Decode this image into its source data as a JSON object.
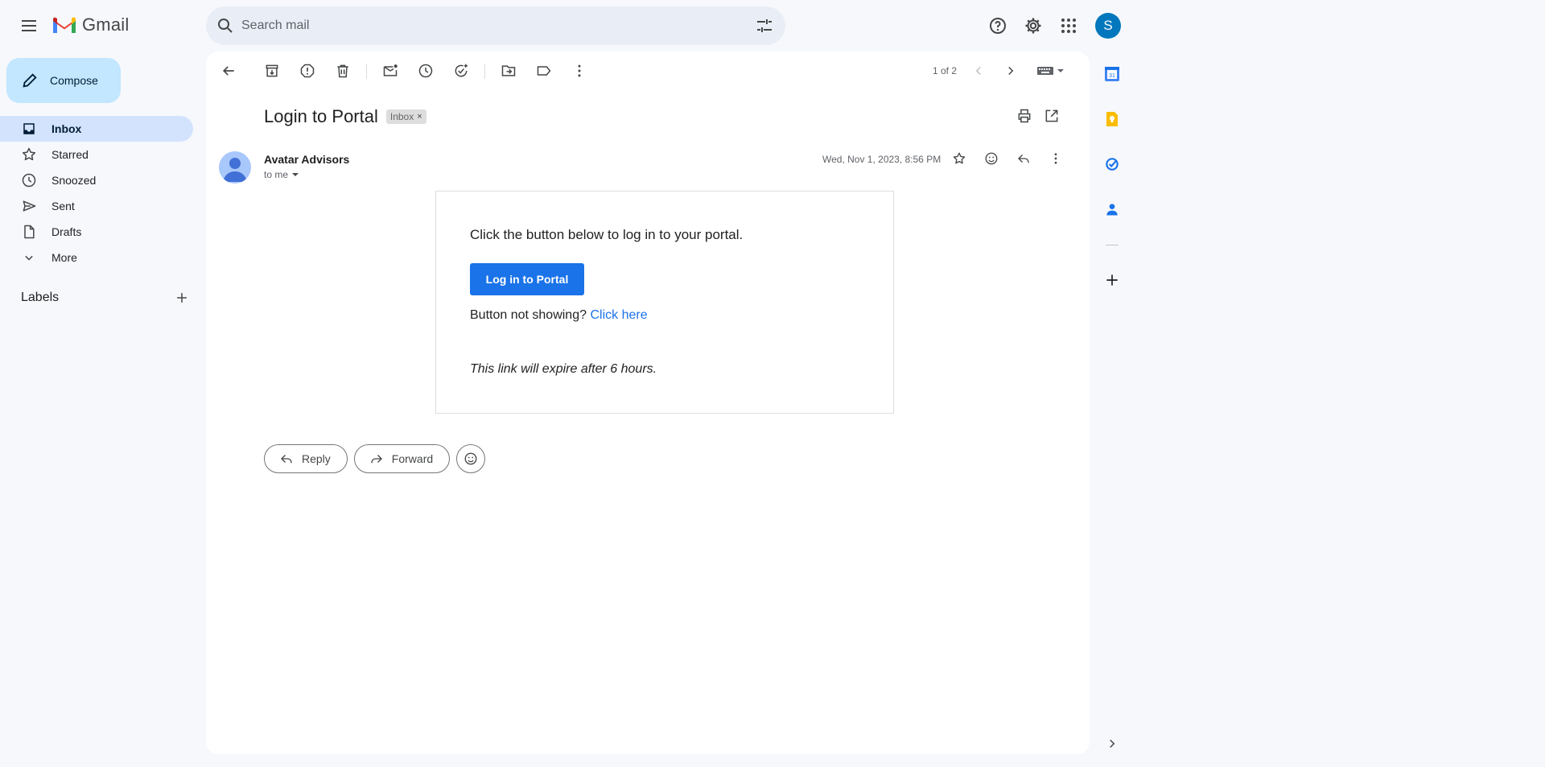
{
  "app": {
    "name": "Gmail"
  },
  "search": {
    "placeholder": "Search mail"
  },
  "account": {
    "initial": "S",
    "color": "#0277bd"
  },
  "compose": {
    "label": "Compose"
  },
  "nav": {
    "items": [
      {
        "label": "Inbox",
        "icon": "inbox-icon",
        "active": true
      },
      {
        "label": "Starred",
        "icon": "star-icon"
      },
      {
        "label": "Snoozed",
        "icon": "clock-icon"
      },
      {
        "label": "Sent",
        "icon": "send-icon"
      },
      {
        "label": "Drafts",
        "icon": "draft-icon"
      },
      {
        "label": "More",
        "icon": "chevron-down-icon"
      }
    ],
    "labels_title": "Labels"
  },
  "toolbar": {
    "pager": "1 of 2"
  },
  "message": {
    "subject": "Login to Portal",
    "label_chip": "Inbox",
    "sender": "Avatar Advisors",
    "to": "to me",
    "date": "Wed, Nov 1, 2023, 8:56 PM"
  },
  "email_body": {
    "intro": "Click the button below to log in to your portal.",
    "button_label": "Log in to Portal",
    "fallback_prefix": "Button not showing?",
    "fallback_link": "Click here",
    "expiry_note": "This link will expire after 6 hours."
  },
  "actions": {
    "reply": "Reply",
    "forward": "Forward"
  },
  "colors": {
    "accent": "#1a73e8",
    "compose_bg": "#c2e7ff",
    "active_nav": "#d3e3fd",
    "page_bg": "#f6f8fc"
  }
}
